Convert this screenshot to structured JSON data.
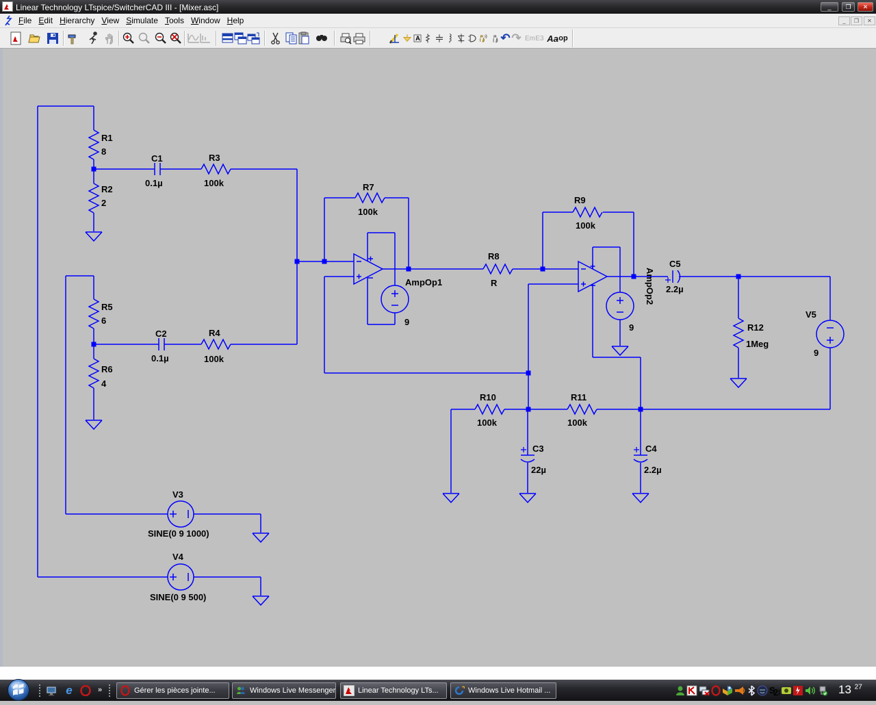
{
  "window": {
    "title": "Linear Technology LTspice/SwitcherCAD III - [Mixer.asc]",
    "controls": {
      "minimize": "_",
      "restore": "❐",
      "close": "✕"
    }
  },
  "menubar": {
    "items": [
      {
        "label": "File"
      },
      {
        "label": "Edit"
      },
      {
        "label": "Hierarchy"
      },
      {
        "label": "View"
      },
      {
        "label": "Simulate"
      },
      {
        "label": "Tools"
      },
      {
        "label": "Window"
      },
      {
        "label": "Help"
      }
    ]
  },
  "toolbar": {
    "icon_names": [
      "new-schematic",
      "open",
      "save",
      "control-panel",
      "run",
      "halt",
      "zoom-in",
      "zoom-full",
      "zoom-out",
      "zoom-extents",
      "waveform-pan",
      "waveform-zoom",
      "cascade-windows",
      "tile-horizontal",
      "tile-vertical",
      "cut",
      "copy",
      "paste",
      "find",
      "print-preview",
      "print",
      "wire",
      "ground",
      "label-net",
      "resistor",
      "capacitor",
      "inductor",
      "diode",
      "gate",
      "component",
      "drag",
      "undo",
      "redo",
      "edit-attributes",
      "edit-text",
      "text",
      "spice-directive"
    ]
  },
  "schematic": {
    "resistors": {
      "R1": {
        "name": "R1",
        "value": "8"
      },
      "R2": {
        "name": "R2",
        "value": "2"
      },
      "R3": {
        "name": "R3",
        "value": "100k"
      },
      "R4": {
        "name": "R4",
        "value": "100k"
      },
      "R5": {
        "name": "R5",
        "value": "6"
      },
      "R6": {
        "name": "R6",
        "value": "4"
      },
      "R7": {
        "name": "R7",
        "value": "100k"
      },
      "R8": {
        "name": "R8",
        "value": "R"
      },
      "R9": {
        "name": "R9",
        "value": "100k"
      },
      "R10": {
        "name": "R10",
        "value": "100k"
      },
      "R11": {
        "name": "R11",
        "value": "100k"
      },
      "R12": {
        "name": "R12",
        "value": "1Meg"
      }
    },
    "capacitors": {
      "C1": {
        "name": "C1",
        "value": "0.1µ"
      },
      "C2": {
        "name": "C2",
        "value": "0.1µ"
      },
      "C3": {
        "name": "C3",
        "value": "22µ"
      },
      "C4": {
        "name": "C4",
        "value": "2.2µ"
      },
      "C5": {
        "name": "C5",
        "value": "2.2µ"
      }
    },
    "opamps": {
      "a1": {
        "name": "AmpOp1",
        "supply": "9"
      },
      "a2": {
        "name": "AmpOp2",
        "supply": "9"
      }
    },
    "sources": {
      "V3": {
        "name": "V3",
        "value": "SINE(0 9 1000)"
      },
      "V4": {
        "name": "V4",
        "value": "SINE(0 9 500)"
      },
      "V5": {
        "name": "V5",
        "value": "9"
      }
    }
  },
  "taskbar": {
    "tasks": [
      {
        "label": "Gérer les pièces jointe..."
      },
      {
        "label": "Windows Live Messenger"
      },
      {
        "label": "Linear Technology LTs..."
      },
      {
        "label": "Windows Live Hotmail ..."
      }
    ],
    "clock": {
      "hour": "13",
      "minute": "27"
    }
  }
}
